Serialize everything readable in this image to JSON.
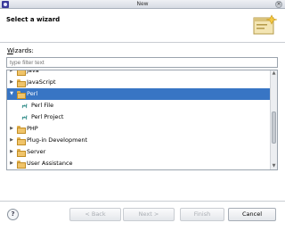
{
  "window": {
    "title": "New"
  },
  "header": {
    "title": "Select a wizard"
  },
  "wizards_label": {
    "mnemonic": "W",
    "rest": "izards:"
  },
  "filter": {
    "placeholder": "type filter text"
  },
  "tree": {
    "rows": [
      {
        "label": "Java",
        "expanded": false,
        "level": 0,
        "type": "folder",
        "selected": false
      },
      {
        "label": "JavaScript",
        "expanded": false,
        "level": 0,
        "type": "folder",
        "selected": false
      },
      {
        "label": "Perl",
        "expanded": true,
        "level": 0,
        "type": "folder",
        "selected": true
      },
      {
        "label": "Perl File",
        "level": 1,
        "type": "perl-item",
        "selected": false
      },
      {
        "label": "Perl Project",
        "level": 1,
        "type": "perl-item",
        "selected": false
      },
      {
        "label": "PHP",
        "expanded": false,
        "level": 0,
        "type": "folder",
        "selected": false
      },
      {
        "label": "Plug-in Development",
        "expanded": false,
        "level": 0,
        "type": "folder",
        "selected": false
      },
      {
        "label": "Server",
        "expanded": false,
        "level": 0,
        "type": "folder",
        "selected": false
      },
      {
        "label": "User Assistance",
        "expanded": false,
        "level": 0,
        "type": "folder",
        "selected": false
      }
    ]
  },
  "buttons": {
    "help": "?",
    "back": "< Back",
    "next": "Next >",
    "finish": "Finish",
    "cancel": "Cancel"
  },
  "colors": {
    "selection": "#3875c4",
    "folder": "#f0c46a",
    "perl_icon": "#2c8a86"
  },
  "icons": {
    "folder": "folder-icon",
    "perl": "perl-camel-icon",
    "help": "help-icon",
    "close": "close-icon"
  }
}
